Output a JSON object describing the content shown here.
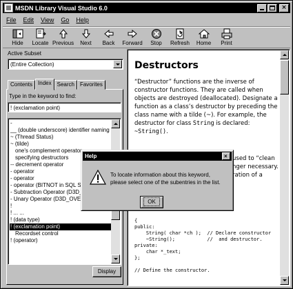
{
  "window": {
    "title": "MSDN Library Visual Studio 6.0"
  },
  "menu": [
    "File",
    "Edit",
    "View",
    "Go",
    "Help"
  ],
  "toolbar": [
    {
      "label": "Hide",
      "icon": "hide-icon"
    },
    {
      "label": "Locate",
      "icon": "locate-icon"
    },
    {
      "label": "Previous",
      "icon": "previous-icon"
    },
    {
      "label": "Next",
      "icon": "next-icon"
    },
    {
      "label": "Back",
      "icon": "back-icon"
    },
    {
      "label": "Forward",
      "icon": "forward-icon"
    },
    {
      "label": "Stop",
      "icon": "stop-icon"
    },
    {
      "label": "Refresh",
      "icon": "refresh-icon"
    },
    {
      "label": "Home",
      "icon": "home-icon"
    },
    {
      "label": "Print",
      "icon": "print-icon"
    }
  ],
  "left": {
    "active_subset_label": "Active Subset",
    "active_subset_value": "(Entire Collection)",
    "tabs": [
      "Contents",
      "Index",
      "Search",
      "Favorites"
    ],
    "active_tab": "Index",
    "keyword_label": "Type in the keyword to find:",
    "keyword_value": "! (exclamation point)",
    "index_items": [
      {
        "text": "-",
        "indent": false
      },
      {
        "text": "__ (double underscore) identifier naming",
        "indent": false
      },
      {
        "text": "~ (Thread Status)",
        "indent": false
      },
      {
        "text": "~ (tilde)",
        "indent": false
      },
      {
        "text": "one's complement operator",
        "indent": true
      },
      {
        "text": "specifying destructors",
        "indent": true
      },
      {
        "text": "-- decrement operator",
        "indent": false
      },
      {
        "text": "- operator",
        "indent": false
      },
      {
        "text": "- operator",
        "indent": false
      },
      {
        "text": "- operator (BITNOT in SQL Ser",
        "indent": false
      },
      {
        "text": "- Subtraction Operator (D3D_C",
        "indent": false
      },
      {
        "text": "- Unary Operator (D3D_OVERL",
        "indent": false
      },
      {
        "text": "!",
        "indent": false
      },
      {
        "text": "! ... ...",
        "indent": false
      },
      {
        "text": "! (data type)",
        "indent": false
      },
      {
        "text": "! (exclamation point)",
        "indent": false,
        "selected": true
      },
      {
        "text": "Recordset control",
        "indent": true
      },
      {
        "text": "! (operator)",
        "indent": false
      }
    ],
    "display_button": "Display"
  },
  "doc": {
    "heading": "Destructors",
    "para_parts": {
      "a": "“Destructor” functions are the inverse of constructor functions. They are called when objects are destroyed (deallocated). Designate a function as a class’s destructor by preceding the class name with a tilde (~). For example, the destructor for class ",
      "code1": "String",
      "b": " is declared: ",
      "code2": "~String()",
      "c": "."
    },
    "partial_lines": [
      "used to “clean",
      "nger necessary.",
      "ration of a"
    ],
    "code_lines": [
      "{",
      "public:",
      "    String( char *ch );  // Declare constructor",
      "    ~String();           //  and destructor.",
      "private:",
      "    char *_text;",
      "};",
      "",
      "// Define the constructor."
    ]
  },
  "dialog": {
    "title": "Help",
    "message_line1": "To locate information about this keyword,",
    "message_line2": "please select one of the subentries in the list.",
    "ok": "OK"
  }
}
